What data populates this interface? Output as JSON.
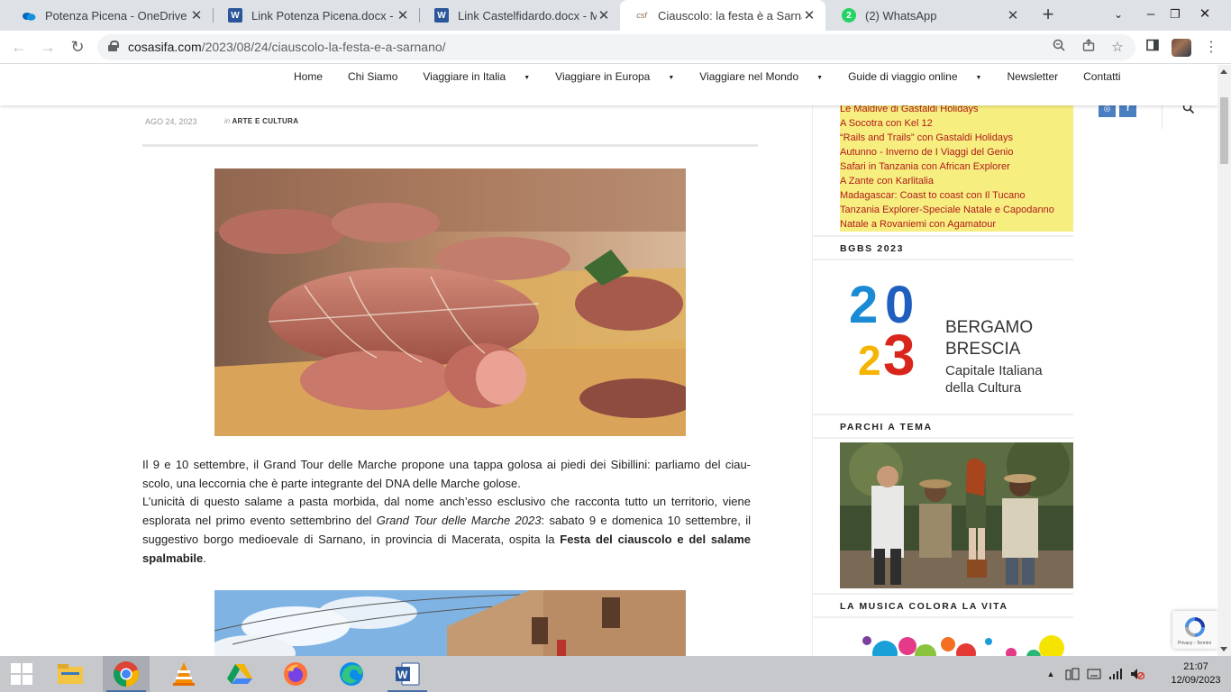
{
  "browser": {
    "tabs": [
      {
        "title": "Potenza Picena - OneDrive",
        "icon": "onedrive-icon"
      },
      {
        "title": "Link Potenza Picena.docx - Micr",
        "icon": "word-icon"
      },
      {
        "title": "Link Castelfidardo.docx - Micro",
        "icon": "word-icon"
      },
      {
        "title": "Ciauscolo: la festa è a Sarnano",
        "icon": "site-favicon",
        "favicon_text": "csf",
        "active": true
      },
      {
        "title": "(2) WhatsApp",
        "icon": "whatsapp-icon",
        "badge": "2"
      }
    ],
    "new_tab": "+",
    "url_host": "cosasifa.com",
    "url_path": "/2023/08/24/ciauscolo-la-festa-e-a-sarnano/"
  },
  "site": {
    "menu": [
      {
        "label": "Home",
        "dropdown": false
      },
      {
        "label": "Chi Siamo",
        "dropdown": false
      },
      {
        "label": "Viaggiare in Italia",
        "dropdown": true
      },
      {
        "label": "Viaggiare in Europa",
        "dropdown": true
      },
      {
        "label": "Viaggiare nel Mondo",
        "dropdown": true
      },
      {
        "label": "Guide di viaggio online",
        "dropdown": true
      },
      {
        "label": "Newsletter",
        "dropdown": false
      },
      {
        "label": "Contatti",
        "dropdown": false
      }
    ],
    "social": {
      "instagram": "◎",
      "facebook": "f"
    }
  },
  "article": {
    "date": "AGO 24, 2023",
    "category_prefix": "in",
    "category": "ARTE E CULTURA",
    "p1": "Il 9 e 10 settembre, il Grand Tour delle Marche propone una tappa golosa ai piedi dei Sibillini: parliamo del ciau-scolo, una leccornia che è parte integrante del DNA delle Marche golose.",
    "p2_a": "L’unicità di questo salame a pasta morbida, dal nome anch’esso esclusivo che racconta tutto un territorio, viene esplorata nel primo evento settembrino del ",
    "p2_italic": "Grand Tour delle Marche 2023",
    "p2_b": ": sabato 9 e domenica 10 settembre, il suggestivo borgo medioevale di Sarnano, in provincia di Macerata, ospita la ",
    "p2_bold": "Festa del ciauscolo e del salame spalmabile",
    "p2_end": "."
  },
  "sidebar": {
    "travel_links": [
      "Le Maldive di Gastaldi Holidays",
      "A Socotra con Kel 12",
      "“Rails and Trails” con Gastaldi Holidays",
      "Autunno - Inverno de I Viaggi del Genio",
      "Safari in Tanzania con African Explorer",
      "A Zante con Karlitalia",
      "Madagascar: Coast to coast con Il Tucano",
      "Tanzania Explorer-Speciale Natale e Capodanno",
      "Natale a Rovaniemi con Agamatour"
    ],
    "widget1_title": "BGBS 2023",
    "bgbs": {
      "digits": [
        "2",
        "0",
        "2",
        "3"
      ],
      "line1": "BERGAMO",
      "line2": "BRESCIA",
      "line3": "Capitale Italiana",
      "line4": "della Cultura"
    },
    "widget2_title": "PARCHI A TEMA",
    "widget3_title": "LA MUSICA COLORA LA VITA",
    "recaptcha_caption": "Privacy - Termini"
  },
  "taskbar": {
    "apps": [
      "windows-start-icon",
      "file-explorer-icon",
      "chrome-icon",
      "vlc-icon",
      "google-drive-icon",
      "firefox-icon",
      "edge-icon",
      "word-icon"
    ],
    "time": "21:07",
    "date": "12/09/2023"
  },
  "colors": {
    "link_red": "#b01a1a",
    "yellow_box": "#f7ee80",
    "social_blue": "#4a7fc1",
    "tab_strip": "#dee1e6"
  }
}
